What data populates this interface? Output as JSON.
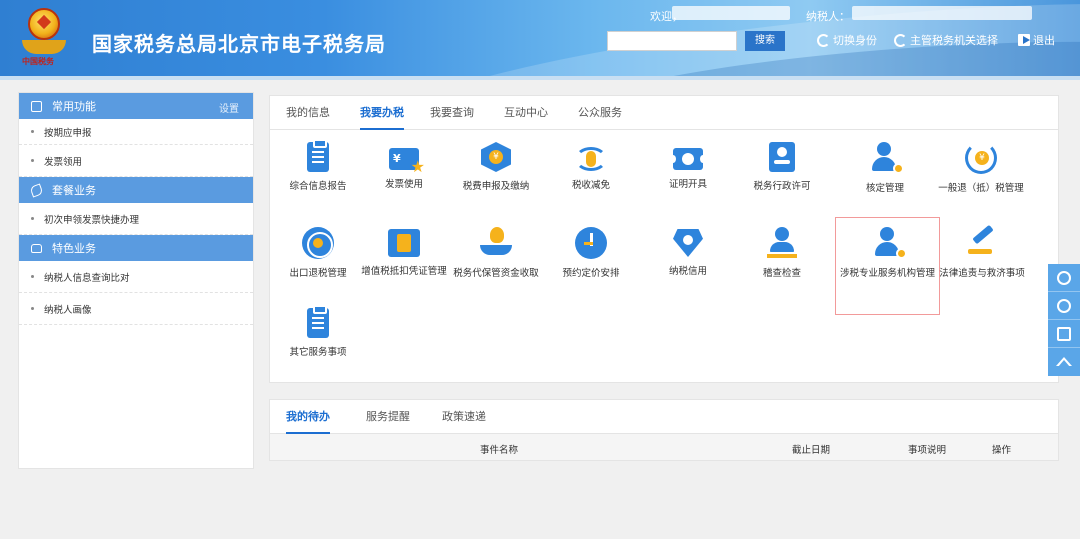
{
  "header": {
    "site_title": "国家税务总局北京市电子税务局",
    "emblem_text": "中国税务",
    "welcome_label": "欢迎，",
    "taxpayer_label": "纳税人：",
    "search_placeholder": "",
    "search_button": "搜索",
    "switch_identity": "切换身份",
    "competent_tax_office": "主管税务机关选择",
    "logout": "退出"
  },
  "sidebar": {
    "section_common": "常用功能",
    "settings": "设置",
    "common_items": [
      "按期应申报",
      "发票领用"
    ],
    "section_package": "套餐业务",
    "package_items": [
      "初次申领发票快捷办理"
    ],
    "section_special": "特色业务",
    "special_items": [
      "纳税人信息查询比对",
      "纳税人画像"
    ]
  },
  "main": {
    "tabs": [
      "我的信息",
      "我要办税",
      "我要查询",
      "互动中心",
      "公众服务"
    ],
    "active_tab": "我要办税",
    "services": [
      {
        "label": "综合信息报告",
        "icon": "report-document-icon"
      },
      {
        "label": "发票使用",
        "icon": "invoice-ticket-icon"
      },
      {
        "label": "税费申报及缴纳",
        "icon": "tax-declaration-icon"
      },
      {
        "label": "税收减免",
        "icon": "tax-relief-coins-icon"
      },
      {
        "label": "证明开具",
        "icon": "certificate-icon"
      },
      {
        "label": "税务行政许可",
        "icon": "license-badge-icon"
      },
      {
        "label": "核定管理",
        "icon": "person-gear-icon"
      },
      {
        "label": "一般退（抵）税管理",
        "icon": "refund-cycle-icon"
      },
      {
        "label": "出口退税管理",
        "icon": "export-globe-icon"
      },
      {
        "label": "增值税抵扣凭证管理",
        "icon": "vat-voucher-icon"
      },
      {
        "label": "税务代保管资金收取",
        "icon": "money-bag-hand-icon"
      },
      {
        "label": "预约定价安排",
        "icon": "pricing-dial-icon"
      },
      {
        "label": "纳税信用",
        "icon": "credit-shield-icon"
      },
      {
        "label": "稽查检查",
        "icon": "inspection-person-icon"
      },
      {
        "label": "涉税专业服务机构管理",
        "icon": "agency-person-gear-icon"
      },
      {
        "label": "法律追责与救济事项",
        "icon": "gavel-icon"
      },
      {
        "label": "其它服务事项",
        "icon": "other-document-icon"
      }
    ],
    "highlighted_service": "涉税专业服务机构管理"
  },
  "todo": {
    "tabs": [
      "我的待办",
      "服务提醒",
      "政策速递"
    ],
    "active_tab": "我的待办",
    "columns": [
      "事件名称",
      "截止日期",
      "事项说明",
      "操作"
    ]
  },
  "float_tools": [
    "chat-icon",
    "help-icon",
    "message-icon",
    "back-to-top-icon"
  ],
  "colors": {
    "primary": "#1c6ed1",
    "icon_blue": "#2e84dc",
    "icon_accent": "#f5b21c",
    "sidebar_head": "#5a9be0",
    "highlight_border": "#f29a9a"
  }
}
